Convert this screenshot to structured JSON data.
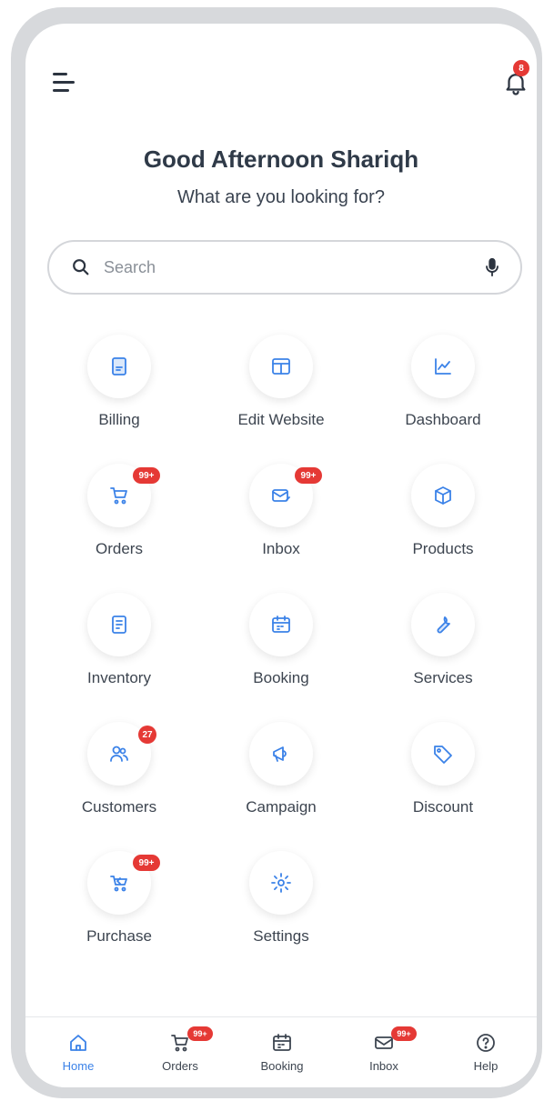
{
  "header": {
    "notification_count": "8",
    "greeting": "Good Afternoon Shariqh",
    "subtitle": "What are you looking for?"
  },
  "search": {
    "placeholder": "Search"
  },
  "tiles": [
    {
      "label": "Billing",
      "icon": "billing-icon",
      "badge": ""
    },
    {
      "label": "Edit Website",
      "icon": "edit-website-icon",
      "badge": ""
    },
    {
      "label": "Dashboard",
      "icon": "dashboard-icon",
      "badge": ""
    },
    {
      "label": "Orders",
      "icon": "cart-icon",
      "badge": "99+"
    },
    {
      "label": "Inbox",
      "icon": "inbox-icon",
      "badge": "99+"
    },
    {
      "label": "Products",
      "icon": "box-icon",
      "badge": ""
    },
    {
      "label": "Inventory",
      "icon": "inventory-icon",
      "badge": ""
    },
    {
      "label": "Booking",
      "icon": "booking-icon",
      "badge": ""
    },
    {
      "label": "Services",
      "icon": "wrench-icon",
      "badge": ""
    },
    {
      "label": "Customers",
      "icon": "customers-icon",
      "badge": "27"
    },
    {
      "label": "Campaign",
      "icon": "megaphone-icon",
      "badge": ""
    },
    {
      "label": "Discount",
      "icon": "tag-icon",
      "badge": ""
    },
    {
      "label": "Purchase",
      "icon": "purchase-icon",
      "badge": "99+"
    },
    {
      "label": "Settings",
      "icon": "gear-icon",
      "badge": ""
    }
  ],
  "bottom_nav": [
    {
      "label": "Home",
      "icon": "home-icon",
      "badge": "",
      "active": true
    },
    {
      "label": "Orders",
      "icon": "cart-icon",
      "badge": "99+",
      "active": false
    },
    {
      "label": "Booking",
      "icon": "calendar-icon",
      "badge": "",
      "active": false
    },
    {
      "label": "Inbox",
      "icon": "mail-icon",
      "badge": "99+",
      "active": false
    },
    {
      "label": "Help",
      "icon": "help-icon",
      "badge": "",
      "active": false
    }
  ],
  "colors": {
    "accent": "#3b82e8",
    "badge": "#e53935",
    "text": "#2f3a48"
  }
}
